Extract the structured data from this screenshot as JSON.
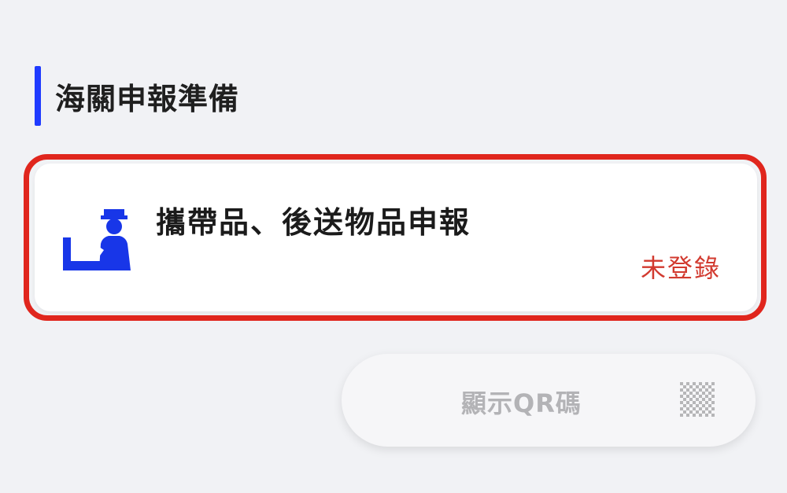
{
  "section": {
    "title": "海關申報準備"
  },
  "declaration_card": {
    "title": "攜帶品、後送物品申報",
    "status": "未登錄",
    "icon": "customs-officer-icon"
  },
  "qr_button": {
    "label": "顯示QR碼",
    "icon": "qr-code-icon"
  },
  "colors": {
    "accent": "#1f3bff",
    "icon_blue": "#1836e8",
    "status_red": "#d23a2f",
    "highlight_red": "#e0261d",
    "background": "#f1f2f5"
  }
}
